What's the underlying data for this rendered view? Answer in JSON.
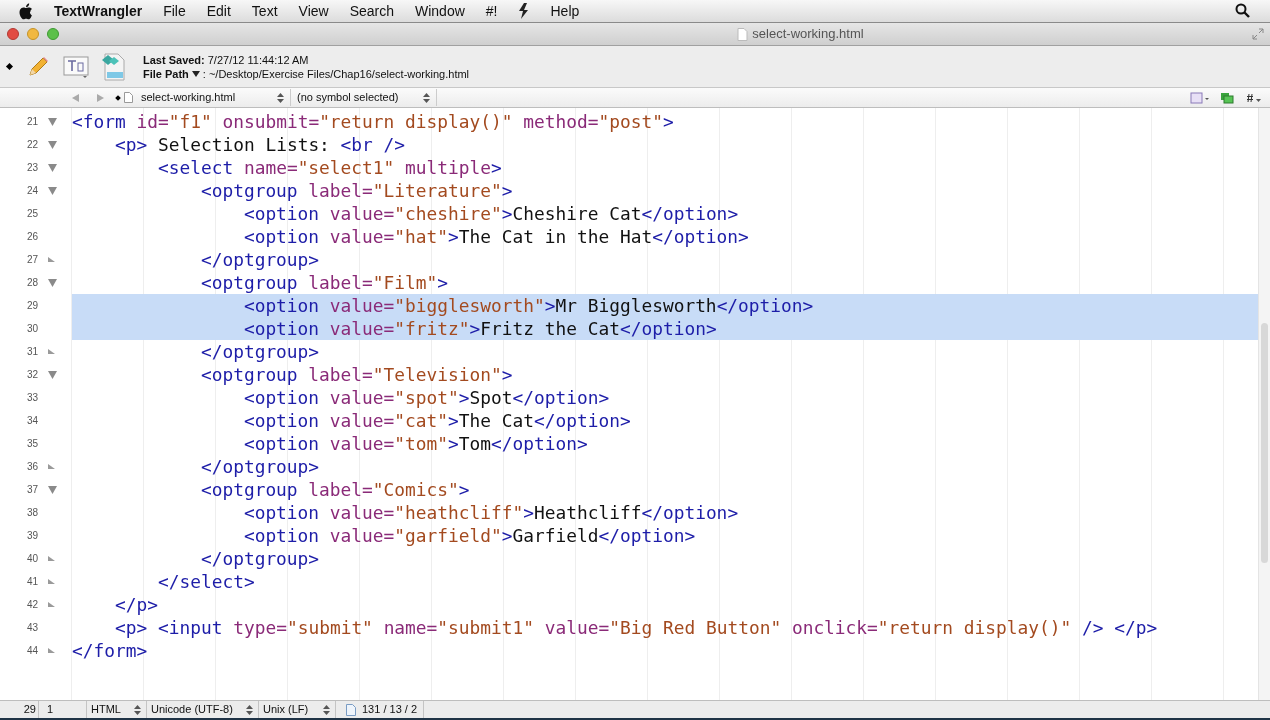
{
  "menu_bar": {
    "app": "TextWrangler",
    "items": [
      {
        "kind": "text",
        "label": "File"
      },
      {
        "kind": "text",
        "label": "Edit"
      },
      {
        "kind": "text",
        "label": "Text"
      },
      {
        "kind": "text",
        "label": "View"
      },
      {
        "kind": "text",
        "label": "Search"
      },
      {
        "kind": "text",
        "label": "Window"
      },
      {
        "kind": "text",
        "label": "#!"
      },
      {
        "kind": "icon"
      },
      {
        "kind": "text",
        "label": "Help"
      }
    ]
  },
  "window": {
    "title": "select-working.html"
  },
  "toolbar": {
    "last_saved_label": "Last Saved:",
    "last_saved": "7/27/12 11:44:12 AM",
    "file_path_label": "File Path",
    "file_path_separator": ":",
    "file_path": "~/Desktop/Exercise Files/Chap16/select-working.html"
  },
  "nav_bar": {
    "file_menu": "select-working.html",
    "symbol_menu": "(no symbol selected)"
  },
  "editor": {
    "lines": [
      {
        "number": "21",
        "text": "<form id=\"f1\" onsubmit=\"return display()\" method=\"post\">",
        "fold_start": true,
        "fold_end": false,
        "selected": false
      },
      {
        "number": "22",
        "text": "    <p> Selection Lists: <br />",
        "fold_start": true,
        "fold_end": false,
        "selected": false
      },
      {
        "number": "23",
        "text": "        <select name=\"select1\" multiple>",
        "fold_start": true,
        "fold_end": false,
        "selected": false
      },
      {
        "number": "24",
        "text": "            <optgroup label=\"Literature\">",
        "fold_start": true,
        "fold_end": false,
        "selected": false
      },
      {
        "number": "25",
        "text": "                <option value=\"cheshire\">Cheshire Cat</option>",
        "fold_start": false,
        "fold_end": false,
        "selected": false
      },
      {
        "number": "26",
        "text": "                <option value=\"hat\">The Cat in the Hat</option>",
        "fold_start": false,
        "fold_end": false,
        "selected": false
      },
      {
        "number": "27",
        "text": "            </optgroup>",
        "fold_start": false,
        "fold_end": true,
        "selected": false
      },
      {
        "number": "28",
        "text": "            <optgroup label=\"Film\">",
        "fold_start": true,
        "fold_end": false,
        "selected": false
      },
      {
        "number": "29",
        "text": "                <option value=\"bigglesworth\">Mr Bigglesworth</option>",
        "fold_start": false,
        "fold_end": false,
        "selected": true
      },
      {
        "number": "30",
        "text": "                <option value=\"fritz\">Fritz the Cat</option>",
        "fold_start": false,
        "fold_end": false,
        "selected": true
      },
      {
        "number": "31",
        "text": "            </optgroup>",
        "fold_start": false,
        "fold_end": true,
        "selected": false
      },
      {
        "number": "32",
        "text": "            <optgroup label=\"Television\">",
        "fold_start": true,
        "fold_end": false,
        "selected": false
      },
      {
        "number": "33",
        "text": "                <option value=\"spot\">Spot</option>",
        "fold_start": false,
        "fold_end": false,
        "selected": false
      },
      {
        "number": "34",
        "text": "                <option value=\"cat\">The Cat</option>",
        "fold_start": false,
        "fold_end": false,
        "selected": false
      },
      {
        "number": "35",
        "text": "                <option value=\"tom\">Tom</option>",
        "fold_start": false,
        "fold_end": false,
        "selected": false
      },
      {
        "number": "36",
        "text": "            </optgroup>",
        "fold_start": false,
        "fold_end": true,
        "selected": false
      },
      {
        "number": "37",
        "text": "            <optgroup label=\"Comics\">",
        "fold_start": true,
        "fold_end": false,
        "selected": false
      },
      {
        "number": "38",
        "text": "                <option value=\"heathcliff\">Heathcliff</option>",
        "fold_start": false,
        "fold_end": false,
        "selected": false
      },
      {
        "number": "39",
        "text": "                <option value=\"garfield\">Garfield</option>",
        "fold_start": false,
        "fold_end": false,
        "selected": false
      },
      {
        "number": "40",
        "text": "            </optgroup>",
        "fold_start": false,
        "fold_end": true,
        "selected": false
      },
      {
        "number": "41",
        "text": "        </select>",
        "fold_start": false,
        "fold_end": true,
        "selected": false
      },
      {
        "number": "42",
        "text": "    </p>",
        "fold_start": false,
        "fold_end": true,
        "selected": false
      },
      {
        "number": "43",
        "text": "    <p> <input type=\"submit\" name=\"submit1\" value=\"Big Red Button\" onclick=\"return display()\" /> </p>",
        "fold_start": false,
        "fold_end": false,
        "selected": false
      },
      {
        "number": "44",
        "text": "</form>",
        "fold_start": false,
        "fold_end": true,
        "selected": false
      }
    ]
  },
  "status_bar": {
    "line": "29",
    "column": "1",
    "language": "HTML",
    "encoding": "Unicode (UTF-8)",
    "line_endings": "Unix (LF)",
    "counts": "131 / 13 / 2"
  }
}
